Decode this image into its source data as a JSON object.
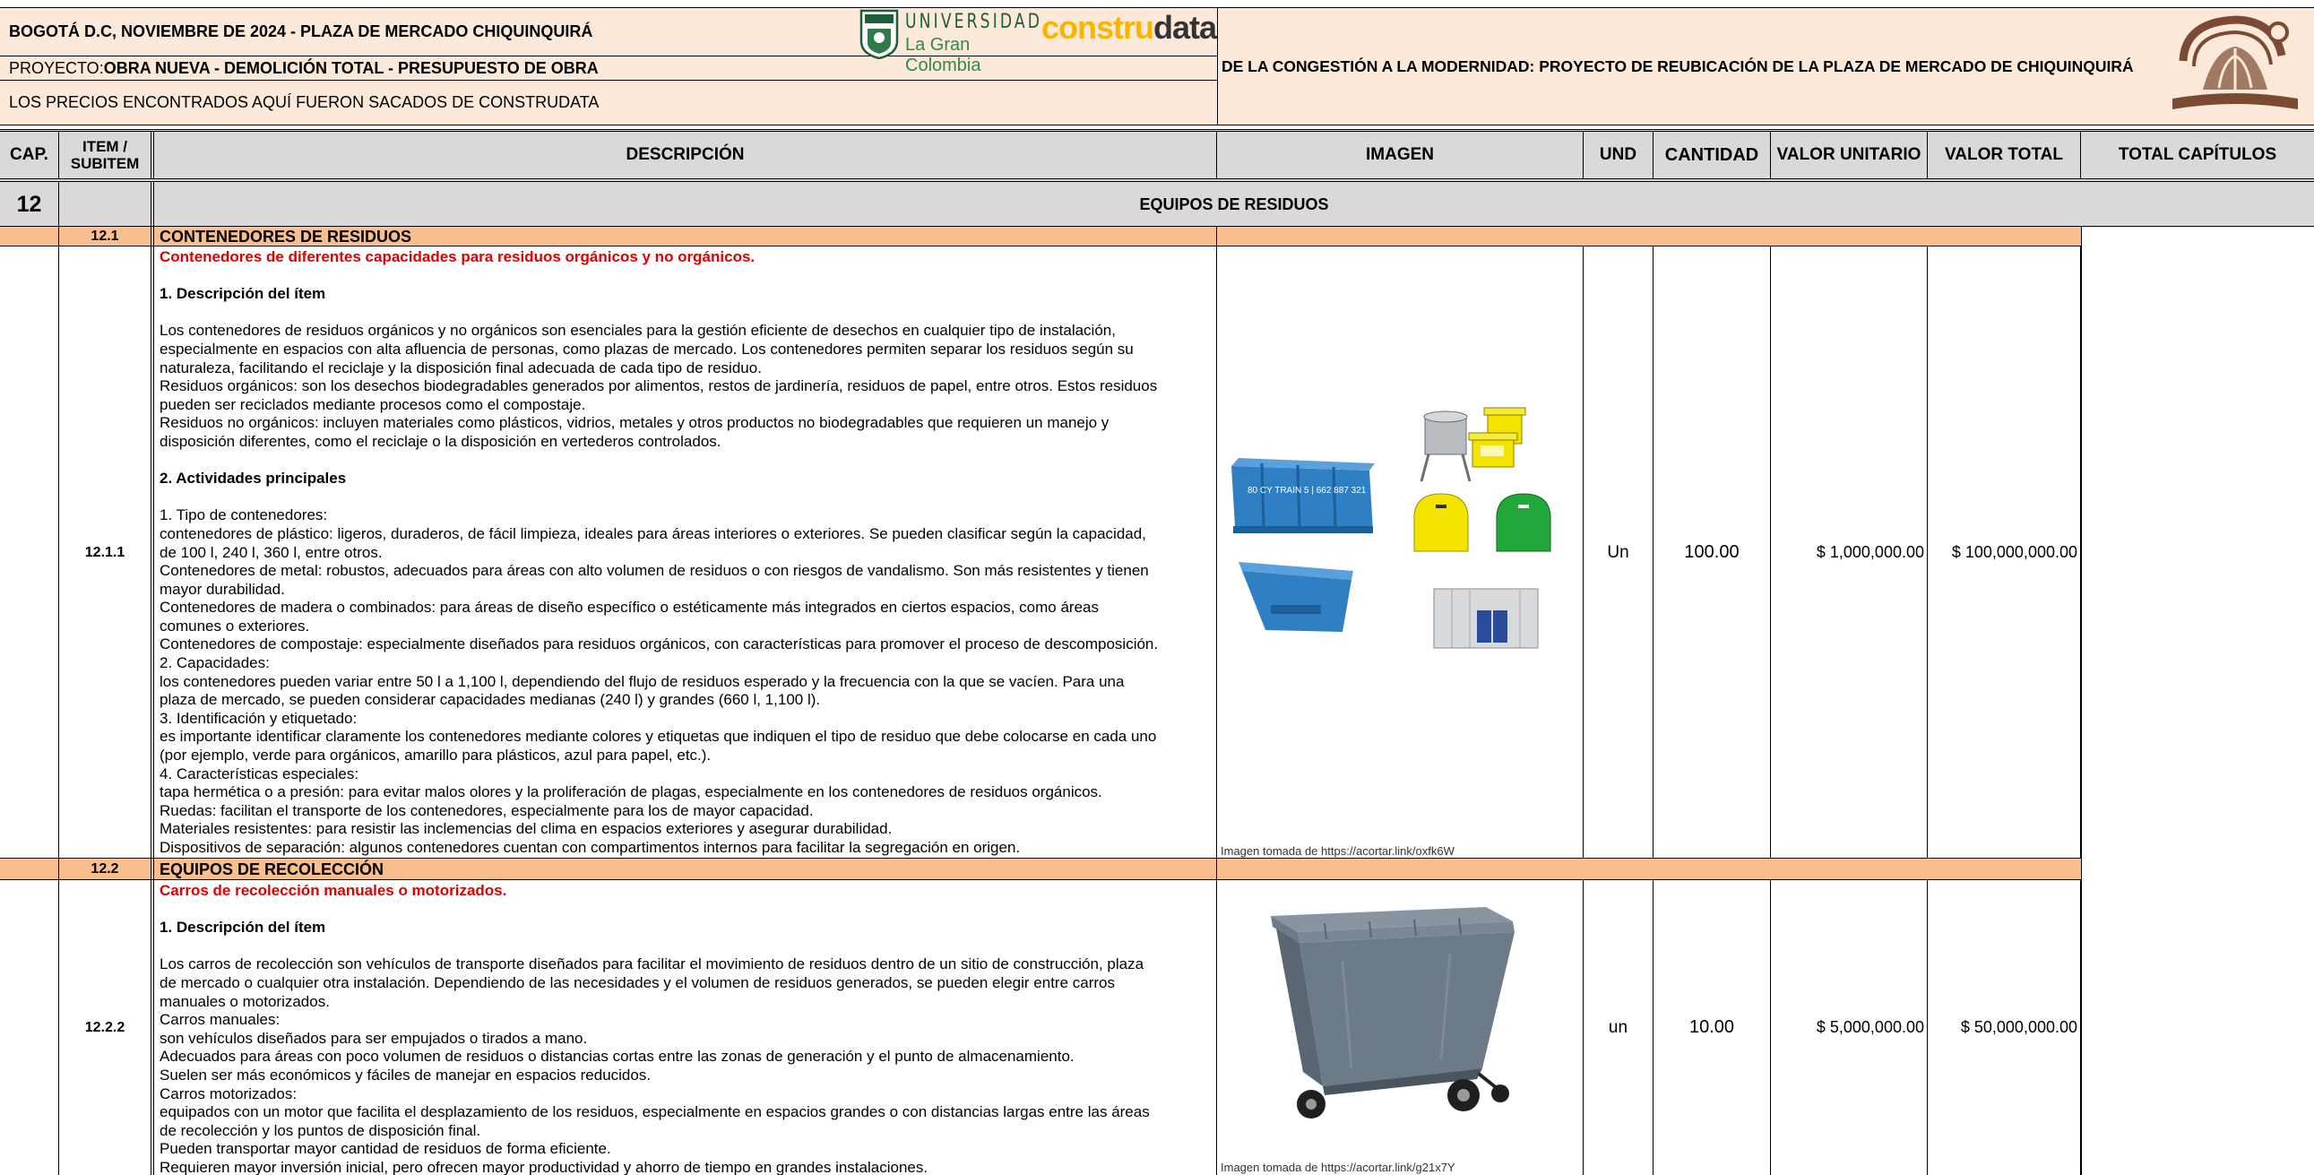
{
  "header": {
    "line1": "BOGOTÁ D.C, NOVIEMBRE DE 2024 - PLAZA DE MERCADO CHIQUINQUIRÁ",
    "line2_prefix": "PROYECTO: ",
    "line2_bold": "OBRA NUEVA - DEMOLICIÓN TOTAL - PRESUPUESTO DE OBRA",
    "line3": "LOS PRECIOS ENCONTRADOS AQUÍ FUERON SACADOS DE CONSTRUDATA",
    "project_title": "DE LA CONGESTIÓN A LA MODERNIDAD: PROYECTO DE REUBICACIÓN DE LA PLAZA DE MERCADO DE CHIQUINQUIRÁ",
    "logo_univ_top": "UNIVERSIDAD",
    "logo_univ_bottom": "La Gran Colombia",
    "logo_cons_a": "con",
    "logo_cons_b": "stru",
    "logo_cons_c": "data"
  },
  "columns": {
    "cap": "CAP.",
    "item": "ITEM / SUBITEM",
    "desc": "DESCRIPCIÓN",
    "img": "IMAGEN",
    "und": "UND",
    "qty": "CANTIDAD",
    "unit": "VALOR UNITARIO",
    "total": "VALOR TOTAL",
    "chapter_total": "TOTAL CAPÍTULOS"
  },
  "chapter": {
    "number": "12",
    "title": "EQUIPOS DE RESIDUOS"
  },
  "sections": [
    {
      "code": "12.1",
      "title": "CONTENEDORES DE RESIDUOS"
    },
    {
      "code": "12.2",
      "title": "EQUIPOS DE RECOLECCIÓN"
    }
  ],
  "items": [
    {
      "code": "12.1.1",
      "title": "Contenedores de diferentes capacidades para residuos orgánicos y no orgánicos.",
      "heading1": "1. Descripción del ítem",
      "para1": [
        "Los contenedores de residuos orgánicos y no orgánicos son esenciales para la gestión eficiente de desechos en cualquier tipo de instalación,",
        "especialmente en espacios con alta afluencia de personas, como plazas de mercado. Los contenedores permiten separar los residuos según su",
        "naturaleza, facilitando el reciclaje y la disposición final adecuada de cada tipo de residuo.",
        "Residuos orgánicos: son los desechos biodegradables generados por alimentos, restos de jardinería, residuos de papel, entre otros. Estos residuos",
        "pueden ser reciclados mediante procesos como el compostaje.",
        "Residuos no orgánicos: incluyen materiales como plásticos, vidrios, metales y otros productos no biodegradables que requieren un manejo y",
        "disposición diferentes, como el reciclaje o la disposición en vertederos controlados."
      ],
      "heading2": "2. Actividades principales",
      "para2": [
        "1. Tipo de contenedores:",
        "contenedores de plástico: ligeros, duraderos, de fácil limpieza, ideales para áreas interiores o exteriores. Se pueden clasificar según la capacidad,",
        "de 100 l, 240 l, 360 l, entre otros.",
        "Contenedores de metal: robustos, adecuados para áreas con alto volumen de residuos o con riesgos de vandalismo. Son más resistentes y tienen",
        "mayor durabilidad.",
        "Contenedores de madera o combinados: para áreas de diseño específico o estéticamente más integrados en ciertos espacios, como áreas",
        "comunes o exteriores.",
        "Contenedores de compostaje: especialmente diseñados para residuos orgánicos, con características para promover el proceso de descomposición.",
        "2. Capacidades:",
        "los contenedores pueden variar entre 50 l a 1,100 l, dependiendo del flujo de residuos esperado y la frecuencia con la que se vacíen. Para una",
        "plaza de mercado, se pueden considerar capacidades medianas (240 l) y grandes (660 l, 1,100 l).",
        "3. Identificación y etiquetado:",
        "es importante identificar claramente los contenedores mediante colores y etiquetas que indiquen el tipo de residuo que debe colocarse en cada uno",
        "(por ejemplo, verde para orgánicos, amarillo para plásticos, azul para papel, etc.).",
        "4. Características especiales:",
        "tapa hermética o a presión: para evitar malos olores y la proliferación de plagas, especialmente en los contenedores de residuos orgánicos.",
        "Ruedas: facilitan el transporte de los contenedores, especialmente para los de mayor capacidad.",
        "Materiales resistentes: para resistir las inclemencias del clima en espacios exteriores y asegurar durabilidad.",
        "Dispositivos de separación: algunos contenedores cuentan con compartimentos internos para facilitar la segregación en origen."
      ],
      "image_credit": "Imagen tomada de https://acortar.link/oxfk6W",
      "container_text": "80 CY TRAIN 5 | 662 887 321",
      "und": "Un",
      "qty": "100.00",
      "unit": "$ 1,000,000.00",
      "total": "$ 100,000,000.00"
    },
    {
      "code": "12.2.2",
      "title": "Carros de recolección manuales o motorizados.",
      "heading1": "1. Descripción del ítem",
      "para1": [
        "Los carros de recolección son vehículos de transporte diseñados para facilitar el movimiento de residuos dentro de un sitio de construcción, plaza",
        "de mercado o cualquier otra instalación. Dependiendo de las necesidades y el volumen de residuos generados, se pueden elegir entre carros",
        "manuales o motorizados.",
        "Carros manuales:",
        "son vehículos diseñados para ser empujados o tirados a mano.",
        "Adecuados para áreas con poco volumen de residuos o distancias cortas entre las zonas de generación y el punto de almacenamiento.",
        "Suelen ser más económicos y fáciles de manejar en espacios reducidos.",
        "Carros motorizados:",
        "equipados con un motor que facilita el desplazamiento de los residuos, especialmente en espacios grandes o con distancias largas entre las áreas",
        "de recolección y los puntos de disposición final.",
        "Pueden transportar mayor cantidad de residuos de forma eficiente.",
        "Requieren mayor inversión inicial, pero ofrecen mayor productividad y ahorro de tiempo en grandes instalaciones."
      ],
      "image_credit": "Imagen tomada de https://acortar.link/g21x7Y",
      "und": "un",
      "qty": "10.00",
      "unit": "$ 5,000,000.00",
      "total": "$ 50,000,000.00"
    }
  ],
  "colors": {
    "header_bg": "#fde9d9",
    "column_header_bg": "#d9d9d9",
    "section_bg": "#fabf8f",
    "item_title_red": "#e00000",
    "bin_blue": "#2f7fc4",
    "bin_yellow": "#f2e300",
    "bin_green": "#22a83a",
    "cart_gray": "#6d7b88"
  }
}
